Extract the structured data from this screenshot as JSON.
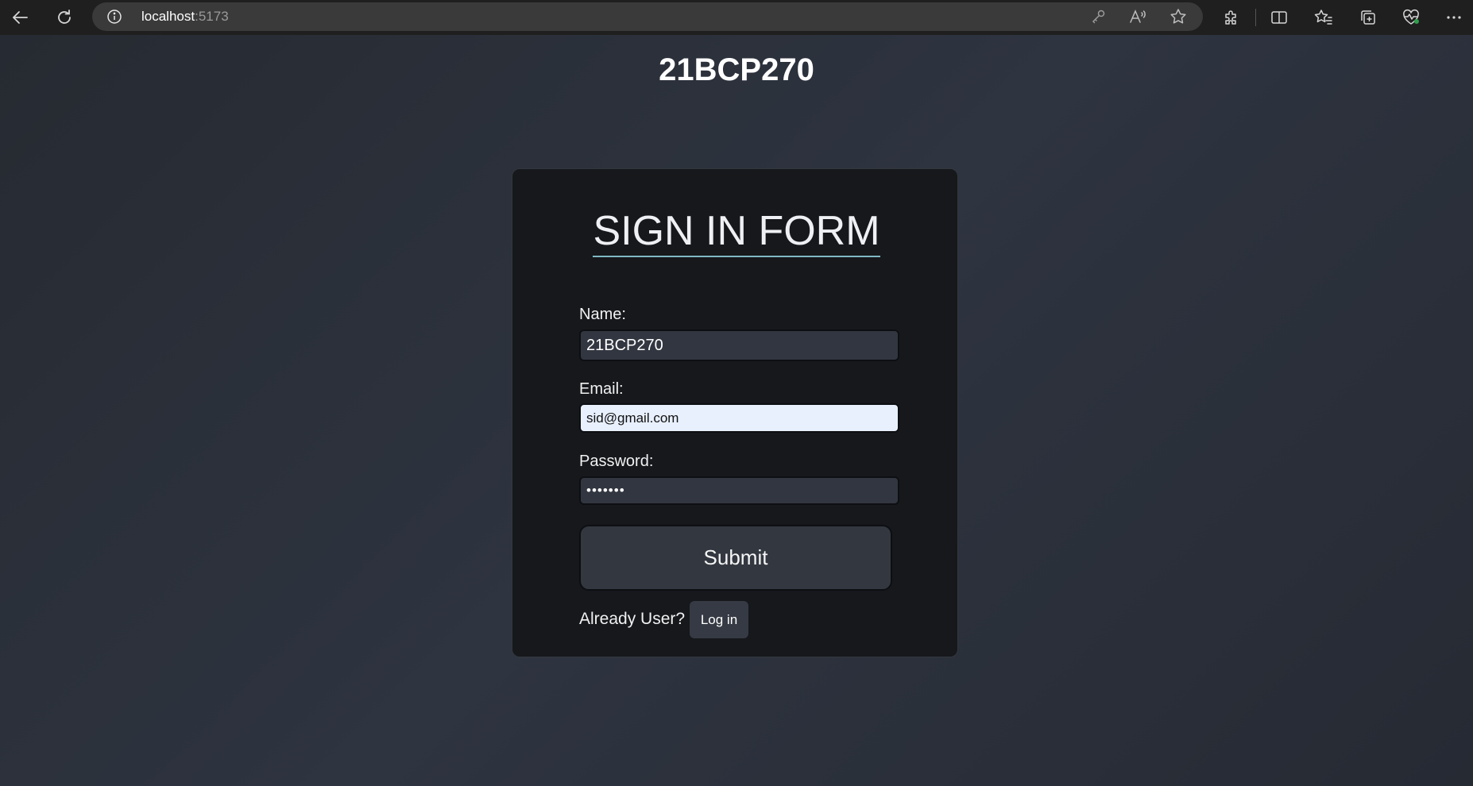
{
  "browser": {
    "url_host": "localhost",
    "url_port": ":5173"
  },
  "page": {
    "heading": "21BCP270"
  },
  "form": {
    "title": "SIGN IN FORM",
    "name_label": "Name:",
    "name_value": "21BCP270",
    "email_label": "Email:",
    "email_value": "sid@gmail.com",
    "password_label": "Password:",
    "password_value": "•••••••",
    "submit_label": "Submit",
    "already_user_text": "Already User?",
    "login_label": "Log in"
  },
  "colors": {
    "card_background": "#16181c",
    "page_background": "#2e3440",
    "title_underline": "#7fb9c4",
    "autofill_background": "#e8f0fe"
  },
  "icons": {
    "back": "back-arrow-icon",
    "refresh": "refresh-icon",
    "site_info": "info-icon",
    "password_manager": "key-icon",
    "read_aloud": "read-aloud-icon",
    "favorite": "star-icon",
    "extensions": "puzzle-icon",
    "split_screen": "split-screen-icon",
    "favorites_list": "favorites-icon",
    "collections": "collections-icon",
    "browser_essentials": "heart-pulse-icon",
    "more": "more-icon"
  }
}
